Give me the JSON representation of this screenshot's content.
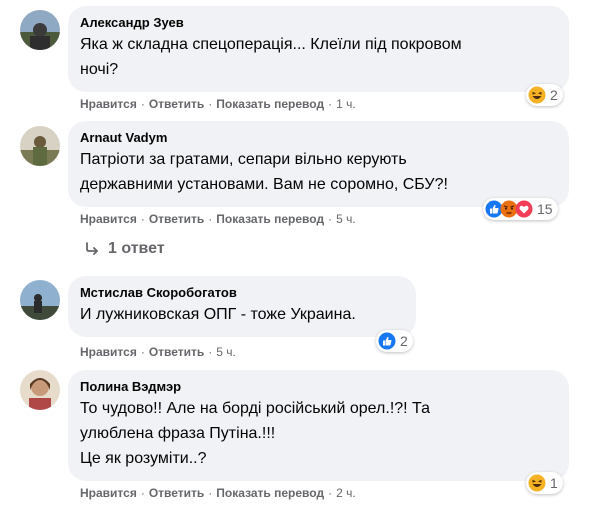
{
  "comments": [
    {
      "author": "Александр Зуев",
      "lines": [
        "Яка ж складна спецоперація... Клеїли під покровом",
        "ночі?"
      ],
      "actions": {
        "like": "Нравится",
        "reply": "Ответить",
        "translate": "Показать перевод",
        "time": "1 ч."
      },
      "reactions": {
        "icons": [
          "haha-icon"
        ],
        "count": "2"
      }
    },
    {
      "author": "Arnaut Vadym",
      "lines": [
        "Патріоти за гратами, сепари вільно керують",
        "державними установами. Вам не соромно, СБУ?!"
      ],
      "actions": {
        "like": "Нравится",
        "reply": "Ответить",
        "translate": "Показать перевод",
        "time": "5 ч."
      },
      "reactions": {
        "icons": [
          "like-icon",
          "angry-icon",
          "love-icon"
        ],
        "count": "15"
      }
    },
    {
      "author": "Мстислав Скоробогатов",
      "lines": [
        "И лужниковская ОПГ - тоже Украина."
      ],
      "actions": {
        "like": "Нравится",
        "reply": "Ответить",
        "time": "5 ч."
      },
      "reactions": {
        "icons": [
          "like-icon"
        ],
        "count": "2"
      }
    },
    {
      "author": "Полина Вэдмэр",
      "lines": [
        "То чудово!! Але на борді російський орел.!?! Та",
        "улюблена фраза Путіна.!!!",
        "Це як розуміти..?"
      ],
      "actions": {
        "like": "Нравится",
        "reply": "Ответить",
        "translate": "Показать перевод",
        "time": "2 ч."
      },
      "reactions": {
        "icons": [
          "haha-icon"
        ],
        "count": "1"
      }
    }
  ],
  "replies_label": "1 ответ",
  "colors": {
    "bubble": "#f0f2f5",
    "meta": "#65676b",
    "like": "#1877f2",
    "haha": "#f7b125",
    "love": "#f33e58",
    "angry": "#e9710f"
  }
}
